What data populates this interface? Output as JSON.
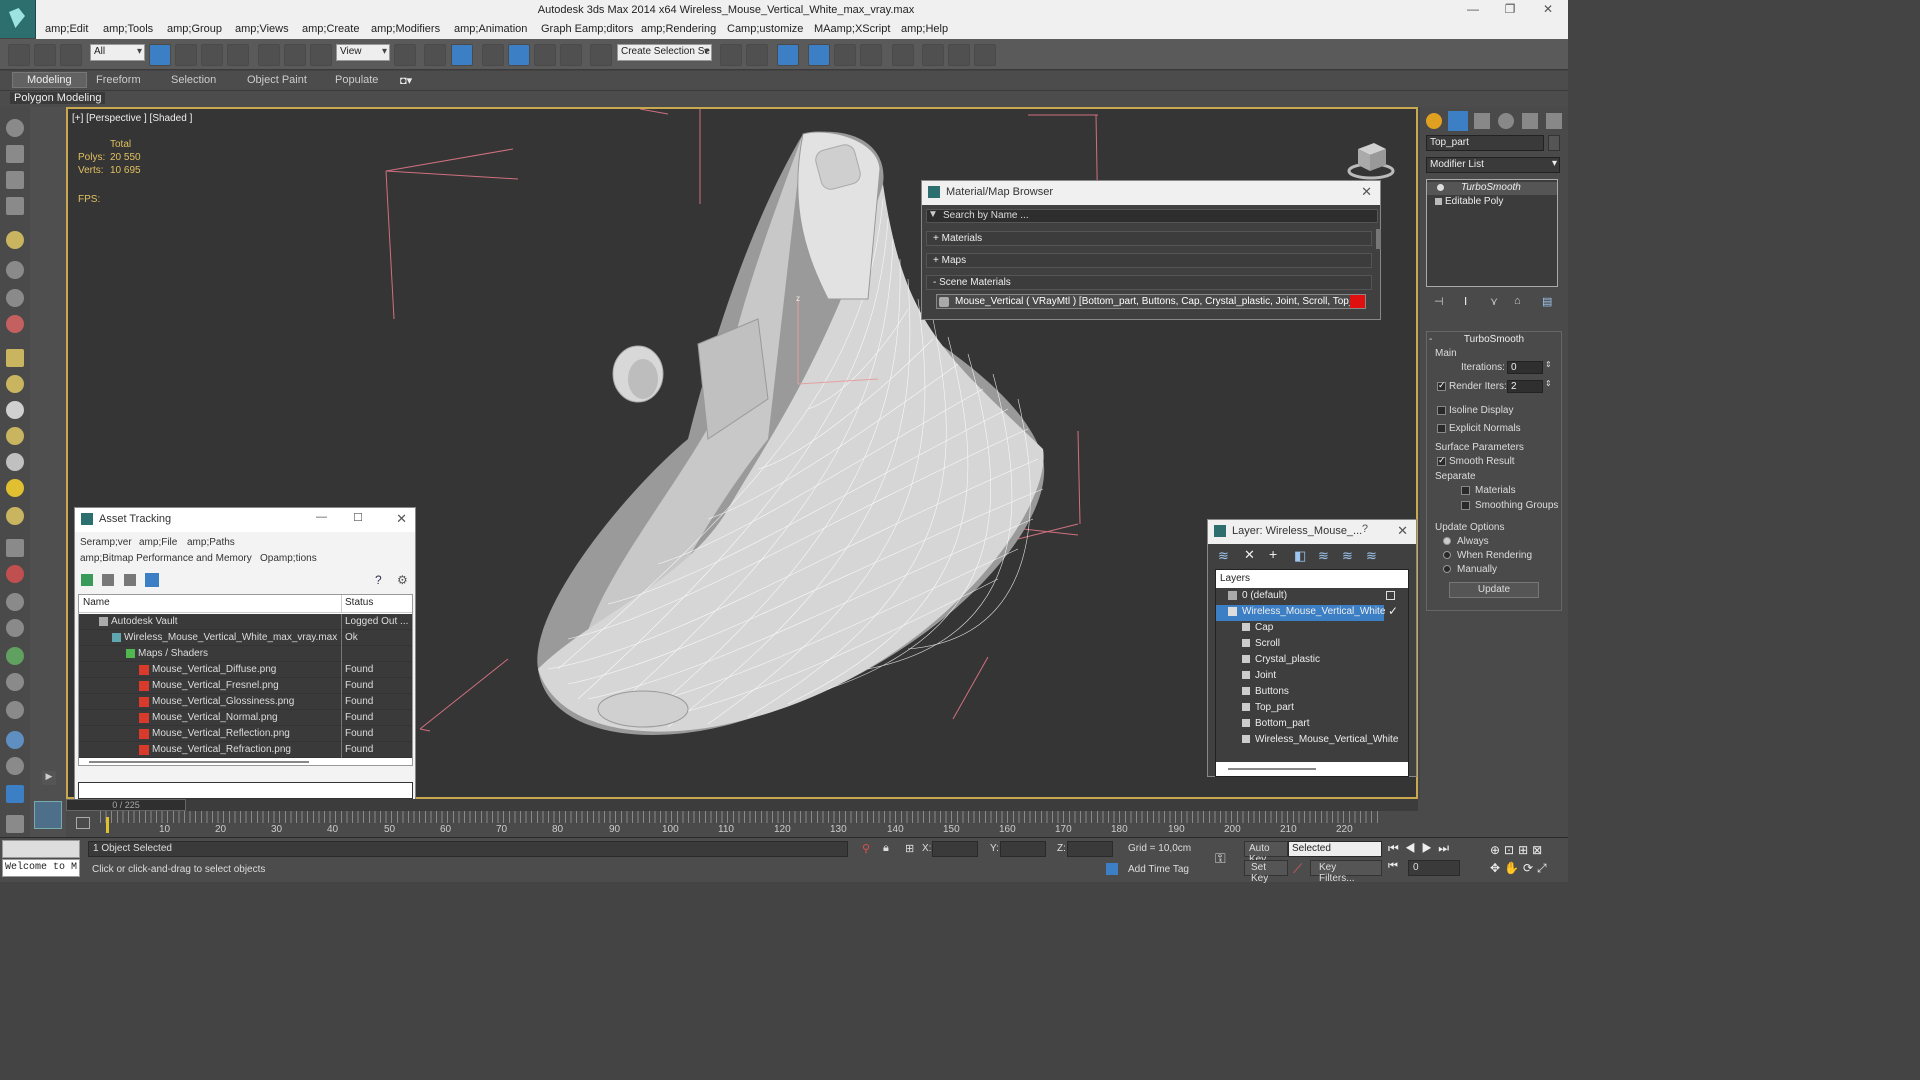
{
  "window": {
    "title": "Autodesk 3ds Max  2014 x64     Wireless_Mouse_Vertical_White_max_vray.max",
    "controls": [
      "—",
      "❐",
      "✕"
    ]
  },
  "menu": [
    "amp;Edit",
    "amp;Tools",
    "amp;Group",
    "amp;Views",
    "amp;Create",
    "amp;Modifiers",
    "amp;Animation",
    "Graph Eamp;ditors",
    "amp;Rendering",
    "Camp;ustomize",
    "MAamp;XScript",
    "amp;Help"
  ],
  "toolbar": {
    "filter": "All",
    "refcoord": "View",
    "selection_set": "Create Selection Se"
  },
  "ribbon": {
    "tabs": [
      "Modeling",
      "Freeform",
      "Selection",
      "Object Paint",
      "Populate"
    ],
    "sub": "Polygon Modeling"
  },
  "viewport": {
    "label": "[+] [Perspective ] [Shaded ]",
    "stats": {
      "total_label": "Total",
      "polys_label": "Polys:",
      "polys": "20 550",
      "verts_label": "Verts:",
      "verts": "10 695",
      "fps_label": "FPS:"
    }
  },
  "material_browser": {
    "title": "Material/Map Browser",
    "search": "Search by Name ...",
    "sections": [
      "+ Materials",
      "+ Maps",
      "- Scene Materials"
    ],
    "material": "Mouse_Vertical  ( VRayMtl ) [Bottom_part, Buttons, Cap, Crystal_plastic, Joint, Scroll, Top_part]"
  },
  "asset_tracking": {
    "title": "Asset Tracking",
    "menu": [
      "Seramp;ver",
      "amp;File",
      "amp;Paths",
      "amp;Bitmap Performance and Memory",
      "Opamp;tions"
    ],
    "columns": [
      "Name",
      "Status"
    ],
    "rows": [
      {
        "name": "Autodesk Vault",
        "status": "Logged Out ..."
      },
      {
        "name": "Wireless_Mouse_Vertical_White_max_vray.max",
        "status": "Ok"
      },
      {
        "name": "Maps / Shaders",
        "status": ""
      },
      {
        "name": "Mouse_Vertical_Diffuse.png",
        "status": "Found"
      },
      {
        "name": "Mouse_Vertical_Fresnel.png",
        "status": "Found"
      },
      {
        "name": "Mouse_Vertical_Glossiness.png",
        "status": "Found"
      },
      {
        "name": "Mouse_Vertical_Normal.png",
        "status": "Found"
      },
      {
        "name": "Mouse_Vertical_Reflection.png",
        "status": "Found"
      },
      {
        "name": "Mouse_Vertical_Refraction.png",
        "status": "Found"
      }
    ]
  },
  "layer_panel": {
    "title": "Layer: Wireless_Mouse_...",
    "header": "Layers",
    "items": [
      "0 (default)",
      "Wireless_Mouse_Vertical_White",
      "Cap",
      "Scroll",
      "Crystal_plastic",
      "Joint",
      "Buttons",
      "Top_part",
      "Bottom_part",
      "Wireless_Mouse_Vertical_White"
    ]
  },
  "command_panel": {
    "object_name": "Top_part",
    "modifier_list": "Modifier List",
    "stack": [
      "TurboSmooth",
      "Editable Poly"
    ],
    "rollout": "TurboSmooth",
    "main": "Main",
    "iterations_label": "Iterations:",
    "iterations": "0",
    "render_iters_label": "Render Iters:",
    "render_iters": "2",
    "isoline": "Isoline Display",
    "explicit": "Explicit Normals",
    "surface": "Surface Parameters",
    "smooth_result": "Smooth Result",
    "separate": "Separate",
    "materials": "Materials",
    "smoothing_groups": "Smoothing Groups",
    "update_options": "Update Options",
    "always": "Always",
    "when_rendering": "When Rendering",
    "manually": "Manually",
    "update": "Update"
  },
  "timeline": {
    "frame": "0 / 225",
    "ticks": [
      "10",
      "20",
      "30",
      "40",
      "50",
      "60",
      "70",
      "80",
      "90",
      "100",
      "110",
      "120",
      "130",
      "140",
      "150",
      "160",
      "170",
      "180",
      "190",
      "200",
      "210",
      "220"
    ]
  },
  "status": {
    "welcome": "Welcome to M",
    "selected": "1 Object Selected",
    "prompt": "Click or click-and-drag to select objects",
    "x": "X:",
    "y": "Y:",
    "z": "Z:",
    "grid": "Grid = 10,0cm",
    "add_time_tag": "Add Time Tag",
    "auto_key": "Auto Key",
    "set_key": "Set Key",
    "key_mode": "Selected",
    "key_filters": "Key Filters...",
    "frame_field": "0"
  }
}
